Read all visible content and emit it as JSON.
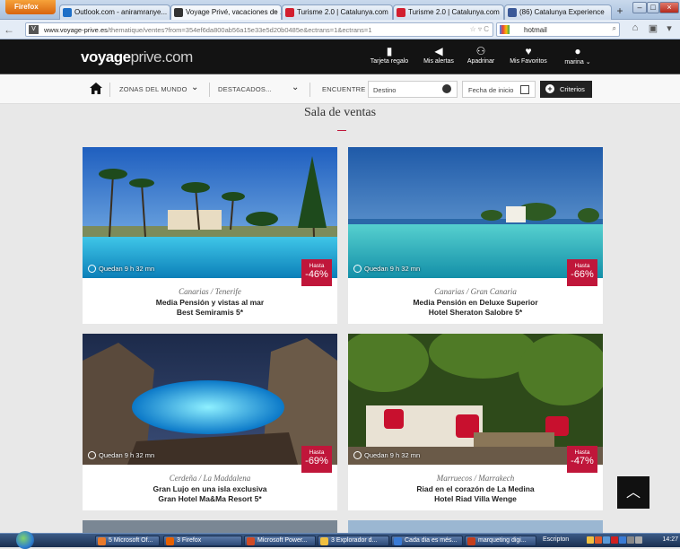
{
  "browser": {
    "menu_label": "Firefox",
    "tabs": [
      {
        "title": "Outlook.com - aniramranye..."
      },
      {
        "title": "Voyage Privé, vacaciones de ..."
      },
      {
        "title": "Turisme 2.0 | Catalunya.com"
      },
      {
        "title": "Turisme 2.0 | Catalunya.com"
      },
      {
        "title": "(86) Catalunya Experience"
      }
    ],
    "url_domain": "www.voyage-prive.es",
    "url_path": "/thematique/ventes?from=354ef6da800ab56a15e33e5d20b0485e&ectrans=1&ectrans=1",
    "search_value": "hotmail"
  },
  "site": {
    "logo_bold": "voyage",
    "logo_light": "prive.com",
    "header_items": [
      {
        "label": "Tarjeta regalo",
        "icon": "gift-card-icon"
      },
      {
        "label": "Mis alertas",
        "icon": "megaphone-icon"
      },
      {
        "label": "Apadrinar",
        "icon": "refer-friend-icon"
      },
      {
        "label": "Mis Favoritos",
        "icon": "heart-icon"
      },
      {
        "label": "marina",
        "icon": "user-icon"
      }
    ],
    "subnav": {
      "zones_label": "ZONAS DEL MUNDO",
      "featured_label": "DESTACADOS...",
      "find_label": "ENCUENTRE :",
      "destination_placeholder": "Destino",
      "date_label": "Fecha de inicio",
      "criteria_label": "Criterios"
    },
    "page_title": "Sala de ventas",
    "cards": [
      {
        "timer": "Quedan 9 h 32 mn",
        "discount_prefix": "Hasta",
        "discount": "-46%",
        "location": "Canarias / Tenerife",
        "line1": "Media Pensión y vistas al mar",
        "line2": "Best Semiramis 5*"
      },
      {
        "timer": "Quedan 9 h 32 mn",
        "discount_prefix": "Hasta",
        "discount": "-66%",
        "location": "Canarias / Gran Canaria",
        "line1": "Media Pensión en Deluxe Superior",
        "line2": "Hotel Sheraton Salobre 5*"
      },
      {
        "timer": "Quedan 9 h 32 mn",
        "discount_prefix": "Hasta",
        "discount": "-69%",
        "location": "Cerdeña / La Maddalena",
        "line1": "Gran Lujo en una isla exclusiva",
        "line2": "Gran Hotel Ma&Ma Resort 5*"
      },
      {
        "timer": "Quedan 9 h 32 mn",
        "discount_prefix": "Hasta",
        "discount": "-47%",
        "location": "Marruecos / Marrakech",
        "line1": "Riad en el corazón de La Medina",
        "line2": "Hotel Riad Villa Wenge"
      }
    ]
  },
  "taskbar": {
    "items": [
      {
        "label": "5 Microsoft Of..."
      },
      {
        "label": "3 Firefox"
      },
      {
        "label": "Microsoft Power..."
      },
      {
        "label": "3 Explorador d..."
      },
      {
        "label": "Cada dia es més..."
      },
      {
        "label": "marqueting digi..."
      }
    ],
    "desktop_label": "Escripton",
    "clock": "14:27"
  },
  "colors": {
    "accent": "#c0163a",
    "header_bg": "#131313"
  }
}
